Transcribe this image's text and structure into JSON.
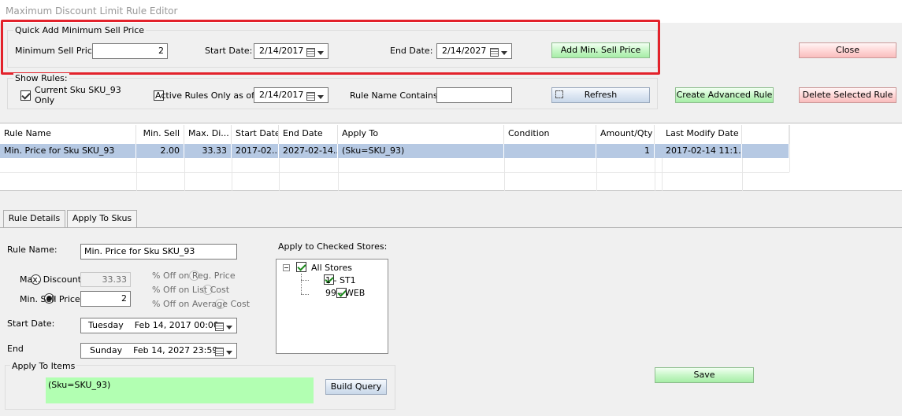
{
  "window": {
    "title": "Maximum Discount Limit Rule Editor"
  },
  "quick_add": {
    "title": "Quick Add Minimum Sell Price",
    "min_sell_label": "Minimum Sell Price:",
    "min_sell_value": "2",
    "start_label": "Start Date:",
    "start_value": "2/14/2017",
    "end_label": "End Date:",
    "end_value": "2/14/2027",
    "add_button": "Add Min. Sell Price"
  },
  "close_button": "Close",
  "show_rules": {
    "title": "Show Rules:",
    "current_sku_label_1": "Current Sku SKU_93",
    "current_sku_label_2": "Only",
    "current_sku_checked": true,
    "active_label": "Active Rules Only as of",
    "active_checked": false,
    "active_date": "2/14/2017",
    "name_contains_label": "Rule Name Contains:",
    "name_contains_value": "",
    "refresh_button": "Refresh"
  },
  "create_advanced_button": "Create Advanced Rule",
  "delete_selected_button": "Delete Selected Rule",
  "grid": {
    "columns": [
      "Rule Name",
      "Min. Sell",
      "Max. Di...",
      "Start Date",
      "End Date",
      "Apply To",
      "Condition",
      "Amount/Qty",
      "Last Modify Date"
    ],
    "rows": [
      [
        "Min. Price for Sku SKU_93",
        "2.00",
        "33.33",
        "2017-02...",
        "2027-02-14...",
        "(Sku=SKU_93)",
        "",
        "1",
        "2017-02-14 11:1..."
      ]
    ]
  },
  "tabs": [
    {
      "label": "Rule Details",
      "active": true
    },
    {
      "label": "Apply To Skus",
      "active": false
    }
  ],
  "details": {
    "rule_name_label": "Rule Name:",
    "rule_name_value": "Min. Price for Sku SKU_93",
    "max_discount_label": "Max. Discount",
    "max_discount_value": "33.33",
    "min_sell_label": "Min. Sell Price",
    "min_sell_value": "2",
    "pct_reg_label": "% Off on Reg. Price",
    "pct_list_label": "% Off on List Cost",
    "pct_avg_label": "% Off on Average Cost",
    "start_label": "Start Date:",
    "start_day": "Tuesday",
    "start_value": "Feb 14, 2017 00:00",
    "end_label": "End",
    "end_day": "Sunday",
    "end_value": "Feb 14, 2027 23:59",
    "apply_items_title": "Apply To Items",
    "apply_items_query": "(Sku=SKU_93)",
    "build_query_button": "Build Query"
  },
  "stores": {
    "title": "Apply to Checked Stores:",
    "root": "All Stores",
    "items": [
      "1 - ST1",
      "99 - WEB"
    ]
  },
  "save_button": "Save",
  "colors": {
    "highlight": "#e3222b",
    "selected_row": "#b6c9e3",
    "green_button": "#c8f7c8",
    "red_button": "#ffd7d7",
    "query_background": "#b2ffb2"
  }
}
